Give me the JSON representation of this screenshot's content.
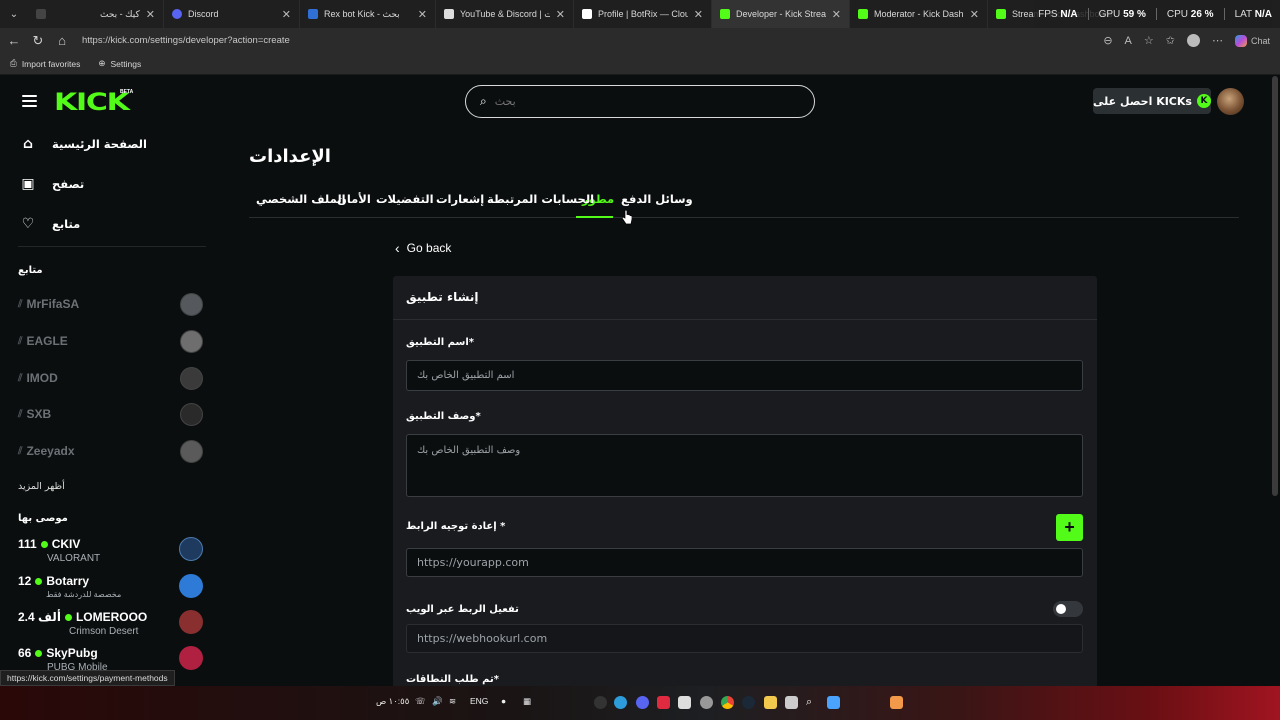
{
  "browser": {
    "tabs": [
      {
        "label": "كيك - بحث",
        "icon_color": "#444444"
      },
      {
        "label": "Discord",
        "icon_color": "#5865f2"
      },
      {
        "label": "Rex bot Kick - بحث",
        "icon_color": "#2f6fd6"
      },
      {
        "label": "YouTube & Discord | التنبيهات",
        "icon_color": "#dddddd"
      },
      {
        "label": "Profile | BotRix — Cloud Stre",
        "icon_color": "#ffffff"
      },
      {
        "label": "Developer - Kick Streaming",
        "icon_color": "#53fc18"
      },
      {
        "label": "Moderator - Kick Dashboard",
        "icon_color": "#53fc18"
      },
      {
        "label": "Stream - Kick Dashboard",
        "icon_color": "#53fc18"
      }
    ],
    "perf": {
      "fps_label": "FPS",
      "fps": "N/A",
      "gpu_label": "GPU",
      "gpu": "59 %",
      "cpu_label": "CPU",
      "cpu": "26 %",
      "lat_label": "LAT",
      "lat": "N/A"
    },
    "url": "https://kick.com/settings/developer?action=create",
    "chat_label": "Chat",
    "bookmarks": {
      "import": "Import favorites",
      "settings": "Settings"
    },
    "status_url": "https://kick.com/settings/payment-methods"
  },
  "kick": {
    "logo": "KICK",
    "beta": "BETA",
    "search_placeholder": "بحث",
    "get_kicks": "احصل على KICKs",
    "nav": {
      "home": "الصفحة الرئيسية",
      "browse": "تصفح",
      "following": "متابع"
    },
    "following_heading": "متابع",
    "followed": [
      {
        "name": "MrFifaSA",
        "color": "#55585c"
      },
      {
        "name": "EAGLE",
        "color": "#6e6e6e"
      },
      {
        "name": "IMOD",
        "color": "#3a3a3a"
      },
      {
        "name": "SXB",
        "color": "#2a2a2a"
      },
      {
        "name": "Zeeyadx",
        "color": "#5a5a5a"
      }
    ],
    "show_more": "أظهر المزيد",
    "recommended_heading": "موصى بها",
    "recommended": [
      {
        "viewers": "111",
        "name": "CKIV",
        "category": "VALORANT",
        "color": "#1e3a5f"
      },
      {
        "viewers": "12",
        "name": "Botarry",
        "category": "مخصصة للدردشة فقط",
        "color": "#2d7bd6"
      },
      {
        "viewers": "2.4 ألف",
        "name": "LOMEROOO",
        "category": "Crimson Desert",
        "color": "#8a2f2f"
      },
      {
        "viewers": "66",
        "name": "SkyPubg",
        "category": "PUBG Mobile",
        "color": "#b02040"
      }
    ],
    "settings_title": "الإعدادات",
    "settings_tabs": {
      "payment": "وسائل الدفع",
      "developer": "مطور",
      "connected": "الحسابات المرتبطة",
      "notifications": "إشعارات",
      "preferences": "التفضيلات",
      "security": "الأمان",
      "profile": "الملف الشخصي"
    },
    "go_back": "Go back",
    "form": {
      "title": "إنشاء تطبيق",
      "app_name_label": "اسم التطبيق*",
      "app_name_placeholder": "اسم التطبيق الخاص بك",
      "app_desc_label": "وصف التطبيق*",
      "app_desc_placeholder": "وصف التطبيق الخاص بك",
      "redirect_label": "إعادة توجيه الرابط *",
      "redirect_placeholder": "https://yourapp.com",
      "webhook_label": "تفعيل الربط عبر الويب",
      "webhook_placeholder": "https://webhookurl.com",
      "scopes_label": "تم طلب النطاقات*"
    }
  },
  "taskbar": {
    "time": "١٠:٥٥ ص",
    "lang": "ENG"
  }
}
